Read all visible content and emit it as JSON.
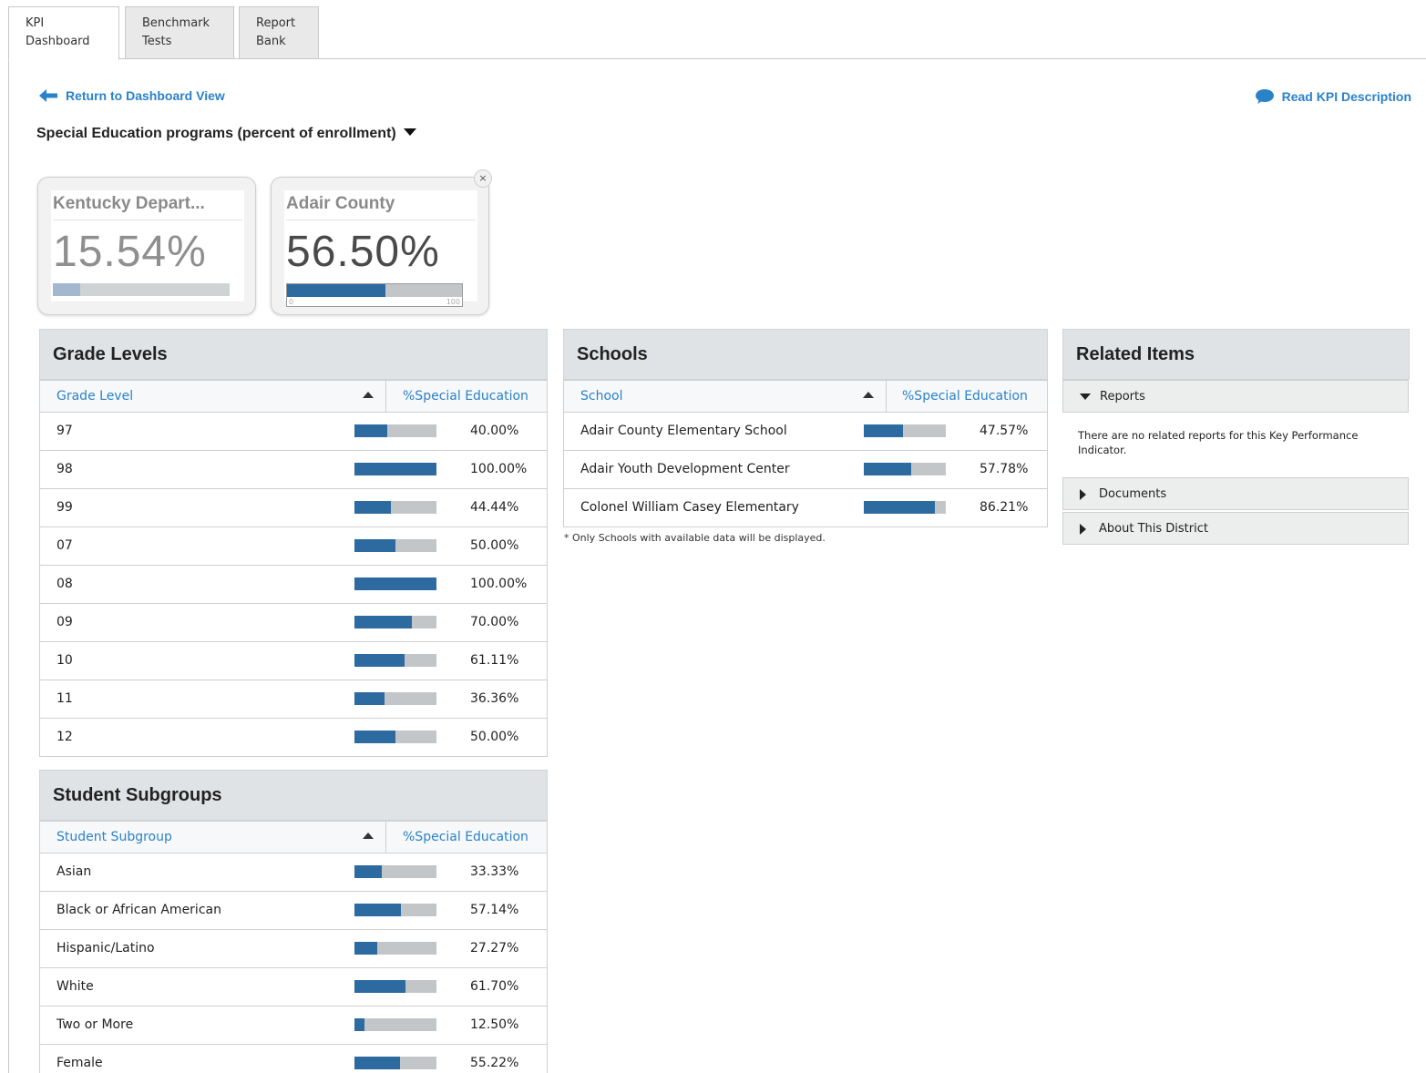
{
  "tabs": [
    {
      "line1": "KPI",
      "line2": "Dashboard"
    },
    {
      "line1": "Benchmark",
      "line2": "Tests"
    },
    {
      "line1": "Report",
      "line2": "Bank"
    }
  ],
  "links": {
    "return": "Return to Dashboard View",
    "read": "Read KPI Description"
  },
  "kpi_selector": "Special Education programs (percent of enrollment)",
  "cards": [
    {
      "name": "Kentucky Depart...",
      "value": "15.54%",
      "percent": 15.54,
      "color": "#a3b8cf"
    },
    {
      "name": "Adair County",
      "value": "56.50%",
      "percent": 56.5,
      "color": "#2c6aa0",
      "scale_min": "0",
      "scale_max": "100"
    }
  ],
  "close_symbol": "×",
  "grade_levels": {
    "title": "Grade Levels",
    "col1": "Grade Level",
    "col2": "%Special Education",
    "rows": [
      {
        "label": "97",
        "pct": "40.00%",
        "value": 40.0
      },
      {
        "label": "98",
        "pct": "100.00%",
        "value": 100.0
      },
      {
        "label": "99",
        "pct": "44.44%",
        "value": 44.44
      },
      {
        "label": "07",
        "pct": "50.00%",
        "value": 50.0
      },
      {
        "label": "08",
        "pct": "100.00%",
        "value": 100.0
      },
      {
        "label": "09",
        "pct": "70.00%",
        "value": 70.0
      },
      {
        "label": "10",
        "pct": "61.11%",
        "value": 61.11
      },
      {
        "label": "11",
        "pct": "36.36%",
        "value": 36.36
      },
      {
        "label": "12",
        "pct": "50.00%",
        "value": 50.0
      }
    ]
  },
  "subgroups": {
    "title": "Student Subgroups",
    "col1": "Student Subgroup",
    "col2": "%Special Education",
    "rows": [
      {
        "label": "Asian",
        "pct": "33.33%",
        "value": 33.33
      },
      {
        "label": "Black or African American",
        "pct": "57.14%",
        "value": 57.14
      },
      {
        "label": "Hispanic/Latino",
        "pct": "27.27%",
        "value": 27.27
      },
      {
        "label": "White",
        "pct": "61.70%",
        "value": 61.7
      },
      {
        "label": "Two or More",
        "pct": "12.50%",
        "value": 12.5
      },
      {
        "label": "Female",
        "pct": "55.22%",
        "value": 55.22
      }
    ]
  },
  "schools": {
    "title": "Schools",
    "col1": "School",
    "col2": "%Special Education",
    "rows": [
      {
        "label": "Adair County Elementary School",
        "pct": "47.57%",
        "value": 47.57
      },
      {
        "label": "Adair Youth Development Center",
        "pct": "57.78%",
        "value": 57.78
      },
      {
        "label": "Colonel William Casey Elementary",
        "pct": "86.21%",
        "value": 86.21
      }
    ],
    "footnote": "* Only Schools with available data will be displayed."
  },
  "related": {
    "title": "Related Items",
    "reports": "Reports",
    "no_reports": "There are no related reports for this Key Performance Indicator.",
    "documents": "Documents",
    "about": "About This District"
  },
  "colors": {
    "accent": "#2a82c8",
    "bar_fill": "#2c6aa0",
    "bar_track": "#c3c6c8"
  }
}
